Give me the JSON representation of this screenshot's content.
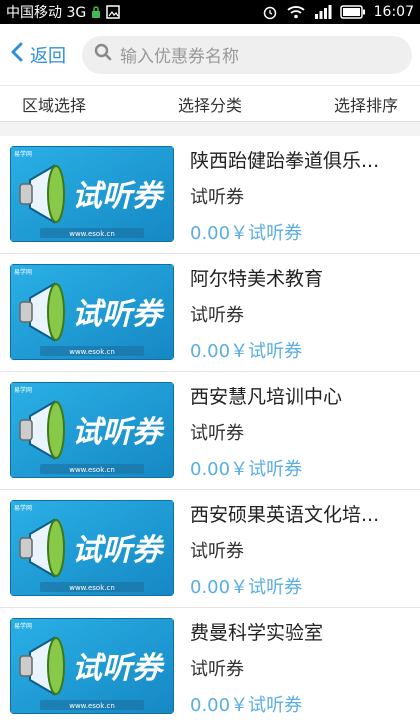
{
  "status": {
    "carrier": "中国移动 3G",
    "time": "16:07"
  },
  "header": {
    "back_label": "返回",
    "search_placeholder": "输入优惠券名称"
  },
  "filters": [
    "区域选择",
    "选择分类",
    "选择排序"
  ],
  "coupon_art": {
    "big_text": "试听券",
    "site": "www.esok.cn",
    "brand": "易学网"
  },
  "items": [
    {
      "title": "陕西跆健跆拳道俱乐...",
      "type": "试听券",
      "price": "0.00￥试听券"
    },
    {
      "title": "阿尔特美术教育",
      "type": "试听券",
      "price": "0.00￥试听券"
    },
    {
      "title": "西安慧凡培训中心",
      "type": "试听券",
      "price": "0.00￥试听券"
    },
    {
      "title": "西安硕果英语文化培...",
      "type": "试听券",
      "price": "0.00￥试听券"
    },
    {
      "title": "费曼科学实验室",
      "type": "试听券",
      "price": "0.00￥试听券"
    }
  ],
  "colors": {
    "accent": "#2f8fd8",
    "price": "#5aaee4",
    "coupon_bg": "#1e9fd6"
  }
}
